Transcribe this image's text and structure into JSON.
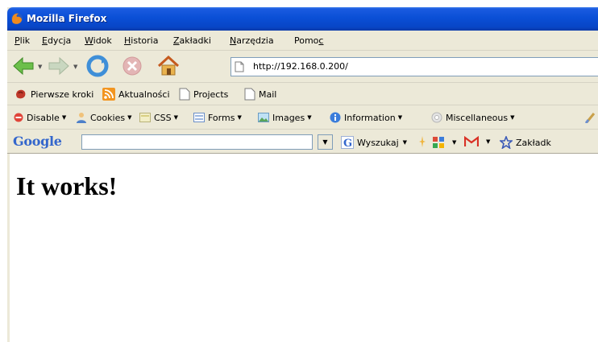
{
  "window": {
    "title": "Mozilla Firefox"
  },
  "menu": {
    "items": [
      {
        "u": "P",
        "rest": "lik"
      },
      {
        "u": "E",
        "rest": "dycja"
      },
      {
        "u": "W",
        "rest": "idok"
      },
      {
        "u": "H",
        "rest": "istoria"
      },
      {
        "u": "Z",
        "rest": "akładki"
      },
      {
        "u": "N",
        "rest": "arzędzia"
      },
      {
        "pre": "Pomo",
        "u": "c"
      }
    ]
  },
  "navigation": {
    "url": "http://192.168.0.200/"
  },
  "bookmarks": {
    "items": [
      "Pierwsze kroki",
      "Aktualności",
      "Projects",
      "Mail"
    ]
  },
  "webdev": {
    "items": [
      "Disable",
      "Cookies",
      "CSS",
      "Forms",
      "Images",
      "Information",
      "Miscellaneous"
    ]
  },
  "google": {
    "logo": "Google",
    "search_value": "",
    "search_label": "Wyszukaj",
    "bookmarks_label": "Zakładk"
  },
  "page": {
    "heading": "It works!"
  },
  "colors": {
    "titlebar": "#0a4fd6",
    "chrome": "#ece9d8",
    "google_blue": "#3366cc"
  }
}
